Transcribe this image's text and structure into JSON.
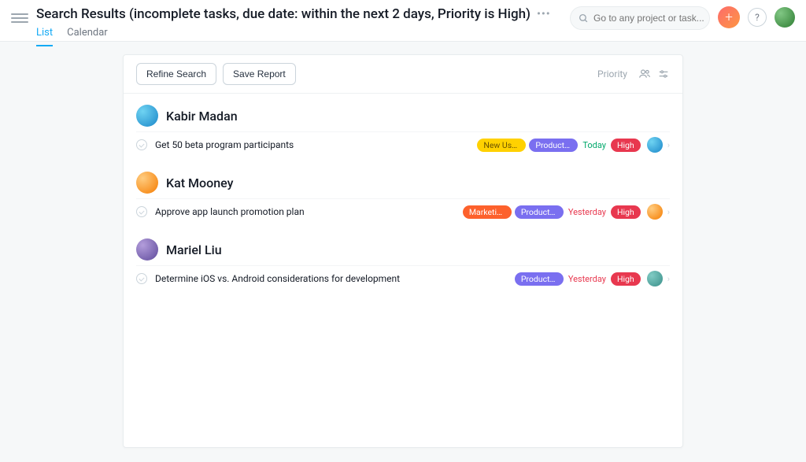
{
  "header": {
    "title": "Search Results (incomplete tasks, due date: within the next 2 days, Priority is High)",
    "tabs": [
      {
        "label": "List",
        "active": true
      },
      {
        "label": "Calendar",
        "active": false
      }
    ]
  },
  "topbar": {
    "search_placeholder": "Go to any project or task...",
    "add_label": "+",
    "help_label": "?"
  },
  "toolbar": {
    "refine_label": "Refine Search",
    "save_label": "Save Report",
    "priority_label": "Priority"
  },
  "pill_colors": {
    "New Users": "pill-yellow",
    "Product launch": "pill-purple",
    "Marketing": "pill-orange",
    "High": "pill-red"
  },
  "groups": [
    {
      "assignee": "Kabir Madan",
      "avatar_class": "av-blue",
      "tasks": [
        {
          "title": "Get 50 beta program participants",
          "pills": [
            "New Users",
            "Product launch"
          ],
          "due": "Today",
          "due_class": "due-today",
          "priority": "High",
          "assignee_avatar": "av-blue"
        }
      ]
    },
    {
      "assignee": "Kat Mooney",
      "avatar_class": "av-orange",
      "tasks": [
        {
          "title": "Approve app launch promotion plan",
          "pills": [
            "Marketing",
            "Product launch"
          ],
          "due": "Yesterday",
          "due_class": "due-yesterday",
          "priority": "High",
          "assignee_avatar": "av-orange"
        }
      ]
    },
    {
      "assignee": "Mariel Liu",
      "avatar_class": "av-purple",
      "tasks": [
        {
          "title": "Determine iOS vs. Android considerations for development",
          "pills": [
            "Product launch"
          ],
          "due": "Yesterday",
          "due_class": "due-yesterday",
          "priority": "High",
          "assignee_avatar": "av-teal"
        }
      ]
    }
  ]
}
